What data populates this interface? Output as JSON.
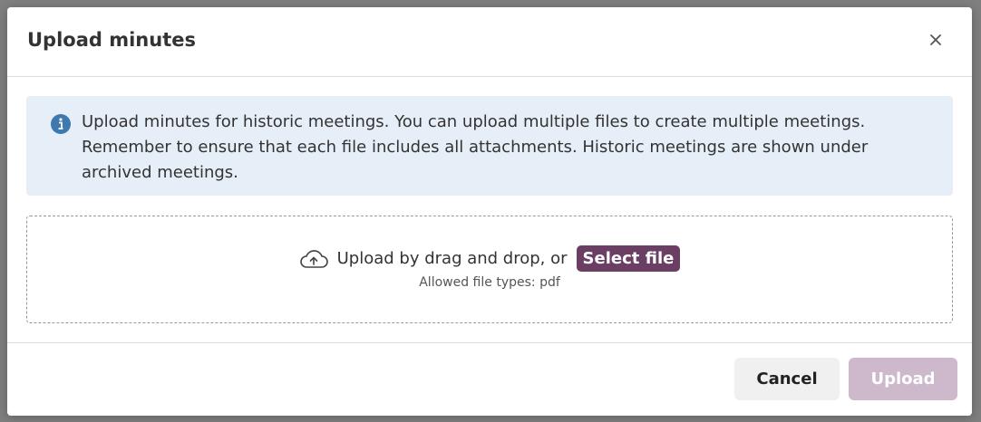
{
  "modal": {
    "title": "Upload minutes",
    "info_text": "Upload minutes for historic meetings. You can upload multiple files to create multiple meetings. Remember to ensure that each file includes all attachments. Historic meetings are shown under archived meetings.",
    "dropzone": {
      "prompt": "Upload by drag and drop, or",
      "select_label": "Select file",
      "allowed_types": "Allowed file types: pdf"
    },
    "footer": {
      "cancel_label": "Cancel",
      "upload_label": "Upload",
      "upload_disabled": true
    }
  },
  "icons": {
    "close": "close-icon",
    "info": "info-icon",
    "upload": "cloud-upload-icon"
  },
  "colors": {
    "accent": "#6b3e64",
    "upload_disabled_bg": "#cdb9cb",
    "info_bg": "#e6eff8",
    "info_icon": "#3d78ae"
  }
}
